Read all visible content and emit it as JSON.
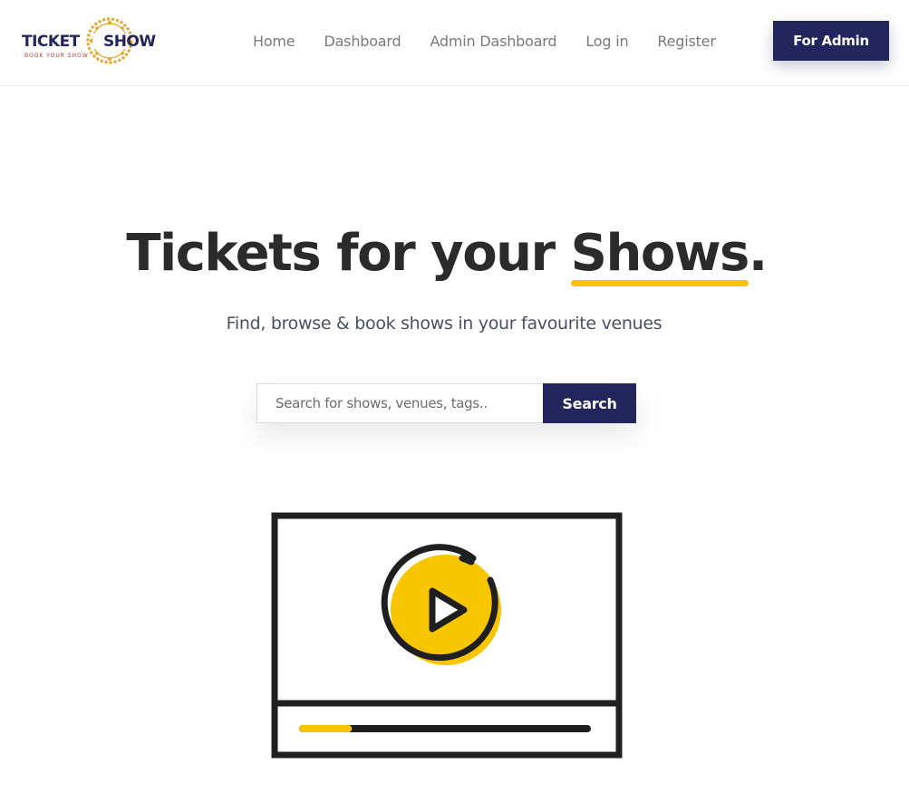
{
  "brand": {
    "name_left": "TICKET",
    "name_right": "SHOW",
    "tagline": "BOOK YOUR SHOW"
  },
  "nav": {
    "links": [
      "Home",
      "Dashboard",
      "Admin Dashboard",
      "Log in",
      "Register"
    ],
    "admin_button": "For Admin"
  },
  "hero": {
    "title_prefix": "Tickets for your ",
    "title_highlight": "Shows",
    "title_suffix": ".",
    "subtitle": "Find, browse & book shows in your favourite venues"
  },
  "search": {
    "placeholder": "Search for shows, venues, tags..",
    "value": "",
    "button_label": "Search"
  },
  "video_player": {
    "progress": 0.16
  },
  "colors": {
    "primary": "#22265c",
    "accent": "#f7c600",
    "text": "#2b2b2b",
    "muted": "#7a7a7a"
  },
  "icons": [
    "film-reel-icon",
    "play-icon"
  ]
}
